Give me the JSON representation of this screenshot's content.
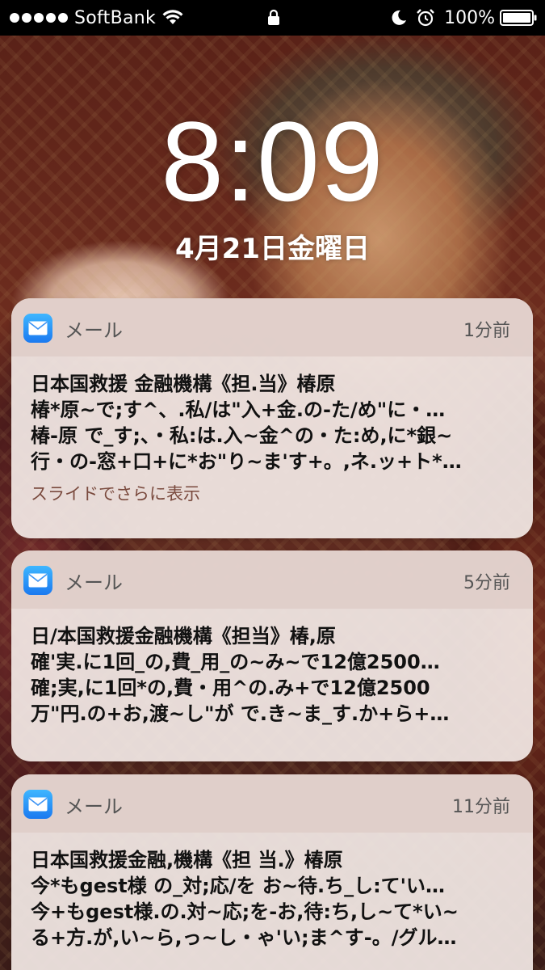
{
  "status_bar": {
    "carrier": "SoftBank",
    "battery": "100%"
  },
  "lock_screen": {
    "time": "8:09",
    "date": "4月21日金曜日"
  },
  "notifications": [
    {
      "app": "メール",
      "time_ago": "1分前",
      "title": "日本国救援 金融機構《担.当》椿原",
      "lines": [
        "椿*原~で;す^、.私/は\"入+金.の-た/め\"に・…",
        "椿-原 で_す;、・私:は.入~金^の・た:め,に*銀~",
        "行・の-窓+口+に*お\"り~ま'す+。,ネ.ッ+ト*…"
      ],
      "more": "スライドでさらに表示"
    },
    {
      "app": "メール",
      "time_ago": "5分前",
      "title": "日/本国救援金融機構《担当》椿,原",
      "lines": [
        "確'実.に1回_の,費_用_の~み~で12億2500…",
        "確;実,に1回*の,費・用^の.み+で12億2500",
        "万\"円.の+お,渡~し\"が で.き~ま_す.か+ら+…"
      ]
    },
    {
      "app": "メール",
      "time_ago": "11分前",
      "title": "日本国救援金融,機構《担 当.》椿原",
      "lines": [
        "今*もgest様 の_対;応/を お~待.ち_し:て'い…",
        "今+もgest様.の.対~応;を-お,待:ち,し~て*い~",
        "る+方.が,い~ら,っ~し・ゃ'い;ま^す-。/グル…"
      ]
    }
  ]
}
